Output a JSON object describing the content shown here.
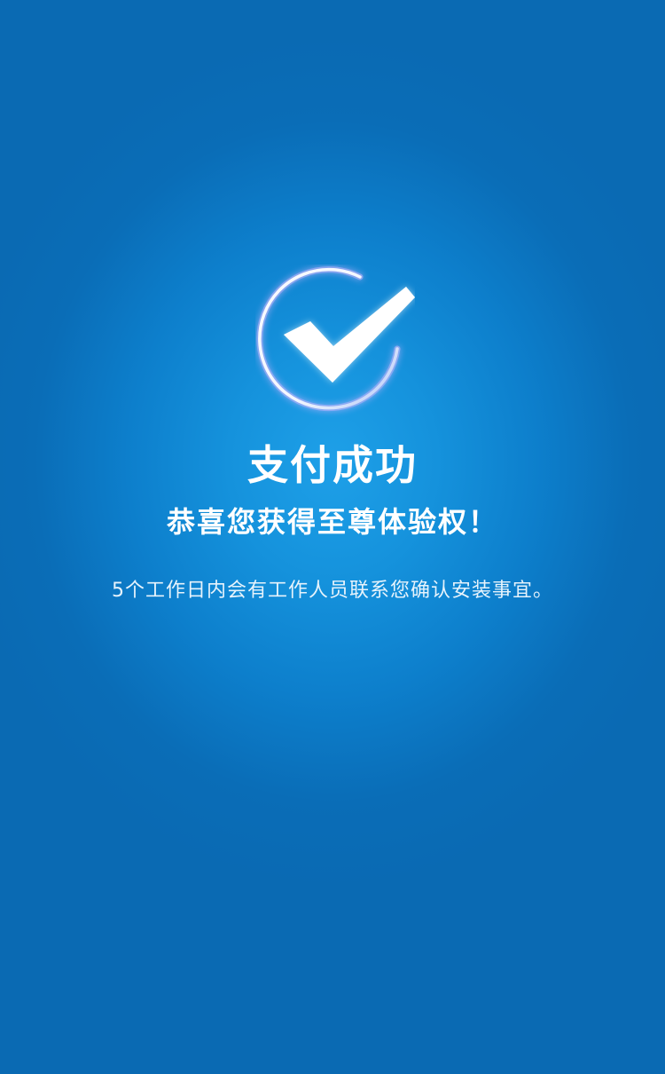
{
  "result": {
    "icon": "checkmark-circle-icon",
    "title": "支付成功",
    "subtitle": "恭喜您获得至尊体验权！",
    "note": "5个工作日内会有工作人员联系您确认安装事宜。"
  },
  "colors": {
    "background_center": "#1ea0e8",
    "background_edge": "#0a6ab3",
    "text": "#ffffff",
    "ring_glow": "#c9b8ff"
  }
}
